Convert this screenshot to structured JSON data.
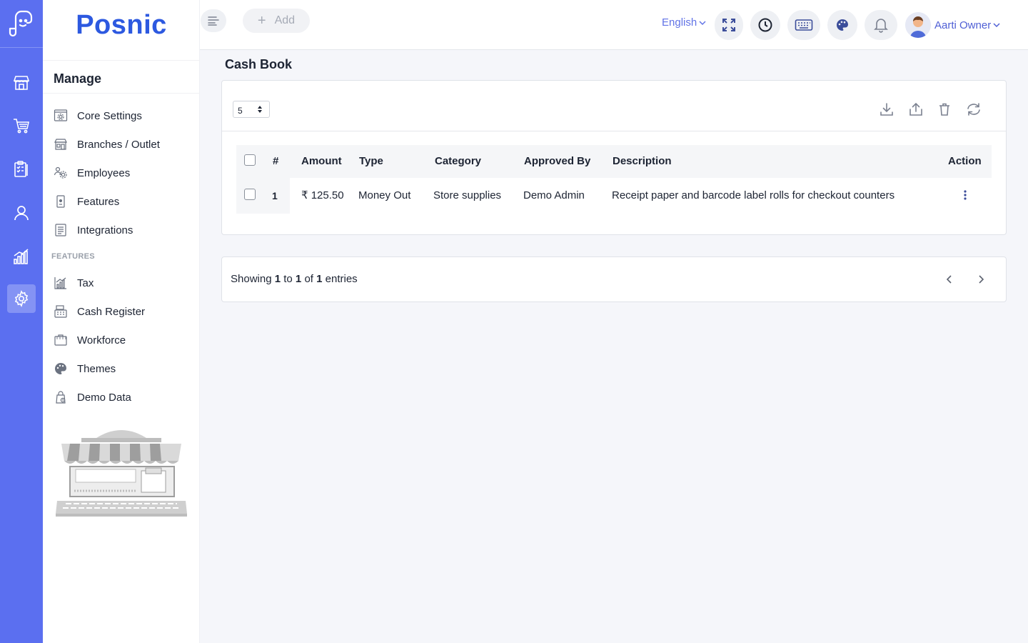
{
  "app": {
    "brand": "Posnic"
  },
  "rail": {
    "items": [
      {
        "icon": "store-icon"
      },
      {
        "icon": "cart-icon"
      },
      {
        "icon": "clipboard-icon"
      },
      {
        "icon": "user-icon"
      },
      {
        "icon": "chart-icon"
      },
      {
        "icon": "gear-icon",
        "active": true
      }
    ]
  },
  "sidebar": {
    "title": "Manage",
    "items": [
      {
        "label": "Core Settings",
        "icon": "settings-panel-icon"
      },
      {
        "label": "Branches / Outlet",
        "icon": "branch-store-icon"
      },
      {
        "label": "Employees",
        "icon": "employees-icon"
      },
      {
        "label": "Features",
        "icon": "features-icon"
      },
      {
        "label": "Integrations",
        "icon": "integrations-icon"
      }
    ],
    "section_label": "FEATURES",
    "feature_items": [
      {
        "label": "Tax",
        "icon": "tax-icon"
      },
      {
        "label": "Cash Register",
        "icon": "cash-register-icon"
      },
      {
        "label": "Workforce",
        "icon": "workforce-icon"
      },
      {
        "label": "Themes",
        "icon": "palette-icon"
      },
      {
        "label": "Demo Data",
        "icon": "demo-data-icon"
      }
    ]
  },
  "topbar": {
    "add_label": "Add",
    "language": "English",
    "user_name": "Aarti Owner",
    "icons": [
      "fullscreen-icon",
      "clock-icon",
      "keyboard-icon",
      "palette-icon",
      "bell-icon"
    ]
  },
  "page": {
    "title": "Cash Book",
    "page_size": "5",
    "toolbar_icons": [
      "download-icon",
      "upload-icon",
      "trash-icon",
      "refresh-icon"
    ]
  },
  "table": {
    "columns": [
      "#",
      "Amount",
      "Type",
      "Category",
      "Approved By",
      "Description",
      "Action"
    ],
    "rows": [
      {
        "index": "1",
        "amount": "₹ 125.50",
        "type": "Money Out",
        "category": "Store supplies",
        "approved_by": "Demo Admin",
        "description": "Receipt paper and barcode label rolls for checkout counters"
      }
    ]
  },
  "pagination": {
    "prefix": "Showing",
    "from": "1",
    "to_word": "to",
    "to": "1",
    "of_word": "of",
    "total": "1",
    "suffix": "entries"
  },
  "colors": {
    "rail_bg": "#5b6ff0",
    "brand": "#2d59e0",
    "accent": "#4f5fd5"
  }
}
